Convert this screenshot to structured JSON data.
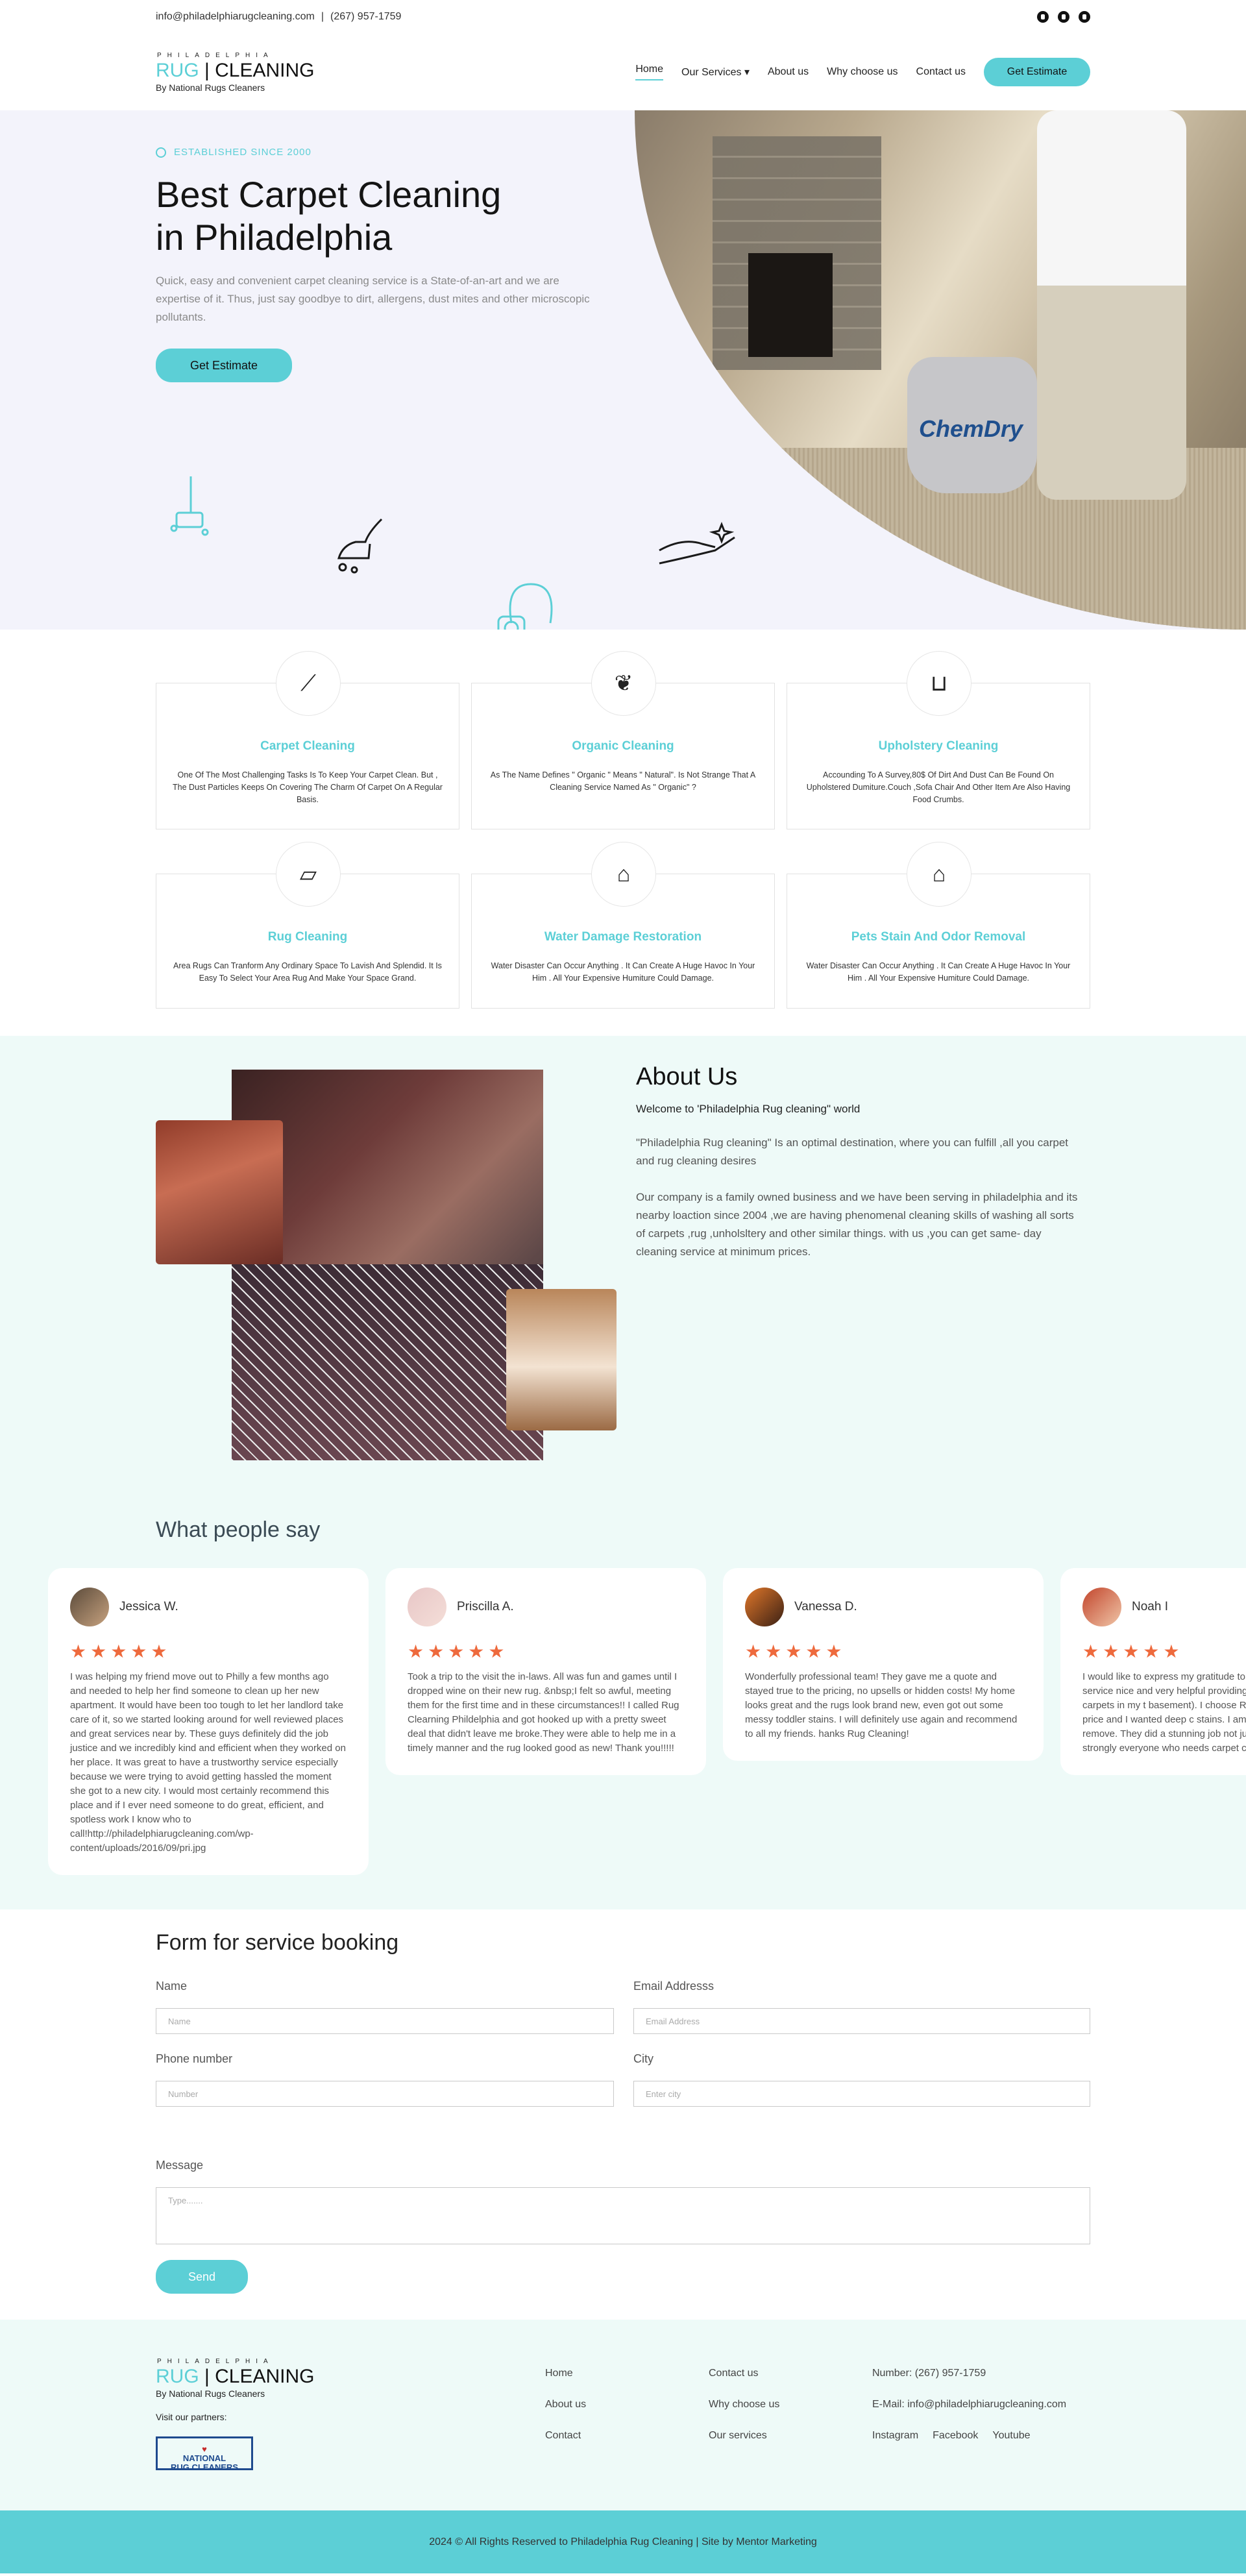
{
  "topbar": {
    "email": "info@philadelphiarugcleaning.com",
    "separator": "|",
    "phone": "(267) 957-1759",
    "social": [
      "facebook-icon",
      "instagram-icon",
      "youtube-icon"
    ]
  },
  "logo": {
    "line1": "PHILADELPHIA",
    "word1": "RUG",
    "word2": "CLEANING",
    "line3": "By National Rugs Cleaners"
  },
  "nav": {
    "items": [
      "Home",
      "Our Services",
      "About us",
      "Why choose us",
      "Contact us"
    ],
    "cta": "Get Estimate"
  },
  "hero": {
    "established": "ESTABLISHED SINCE 2000",
    "title_line1": "Best Carpet Cleaning",
    "title_line2": "in Philadelphia",
    "lead": "Quick, easy and convenient carpet cleaning service is a State-of-an-art and we are expertise of it. Thus, just say goodbye to dirt, allergens, dust mites and other microscopic pollutants.",
    "cta": "Get Estimate"
  },
  "services": [
    {
      "title": "Carpet Cleaning",
      "text": "One Of The Most Challenging Tasks Is To Keep Your Carpet Clean. But , The Dust Particles Keeps On Covering The Charm Of Carpet On A Regular Basis."
    },
    {
      "title": "Organic Cleaning",
      "text": "As The Name Defines \" Organic \" Means \" Natural\". Is Not Strange That A Cleaning Service Named As \" Organic\" ?"
    },
    {
      "title": "Upholstery Cleaning",
      "text": "Accounding To A Survey,80$ Of Dirt And Dust Can Be Found On Upholstered Dumiture.Couch ,Sofa Chair And Other Item Are Also Having Food Crumbs."
    },
    {
      "title": "Rug Cleaning",
      "text": "Area Rugs Can Tranform Any Ordinary Space To Lavish And Splendid. It Is Easy To Select Your Area Rug And Make Your Space Grand."
    },
    {
      "title": "Water Damage Restoration",
      "text": "Water Disaster Can Occur Anything . It Can Create A Huge Havoc In Your Him . All Your Expensive Humiture Could Damage."
    },
    {
      "title": "Pets Stain And Odor Removal",
      "text": "Water Disaster Can Occur Anything . It Can Create A Huge Havoc In Your Him . All Your Expensive Humiture Could Damage."
    }
  ],
  "about": {
    "title": "About Us",
    "welcome": "Welcome to 'Philadelphia Rug cleaning\" world",
    "p1": "\"Philadelphia Rug cleaning\" Is an optimal destination, where you can fulfill ,all you carpet and rug cleaning desires",
    "p2": "Our company is a family owned business and we have been serving in philadelphia and its nearby loaction since 2004 ,we are having phenomenal cleaning skills of washing all sorts of carpets ,rug ,unholsltery and other similar things. with us ,you can get same- day cleaning service at minimum prices."
  },
  "testimonials": {
    "title": "What people say",
    "stars": "★★★★★",
    "items": [
      {
        "name": "Jessica W.",
        "text": "I was helping my friend move out to Philly a few months ago and needed to help her find someone to clean up her new apartment. It would have been too tough to let her landlord take care of it, so we started looking around for well reviewed places and great services near by. These guys definitely did the job justice and we incredibly kind and efficient when they worked on her place. It was great to have a trustworthy service especially because we were trying to avoid getting hassled the moment she got to a new city. I would most certainly recommend this place and if I ever need someone to do great, efficient, and spotless work I know who to call!http://philadelphiarugcleaning.com/wp-content/uploads/2016/09/pri.jpg"
      },
      {
        "name": "Priscilla A.",
        "text": "Took a trip to the visit the in-laws. All was fun and games until I dropped wine on their new rug. &nbsp;I felt so awful, meeting them for the first time and in these circumstances!! I called Rug Clearning Phildelphia and got hooked up with a pretty sweet deal that didn't leave me broke.They were able to help me in a timely manner and the rug looked good as new! Thank you!!!!!"
      },
      {
        "name": "Vanessa D.",
        "text": "Wonderfully professional team! They gave me a quote and stayed true to the pricing, no upsells or hidden costs! My home looks great and the rugs look brand new, even got out some messy toddler stains. I will definitely use again and recommend to all my friends. hanks Rug Cleaning!"
      },
      {
        "name": "Noah I",
        "text": "I would like to express my gratitude to Philadelphia for the wonderful service nice and very helpful providing carpet wanted to clean all my carpets in my t basement). I choose Rug cleaning Phi gave a good price and I wanted deep c stains. I am very impressed – obviousl remove. They did a stunning job not ju my carpets. It was priceless. I strongly everyone who needs carpet cleaning s"
      }
    ]
  },
  "form": {
    "title": "Form for service booking",
    "name_label": "Name",
    "name_placeholder": "Name",
    "email_label": "Email Addresss",
    "email_placeholder": "Email Address",
    "phone_label": "Phone number",
    "phone_placeholder": "Number",
    "city_label": "City",
    "city_placeholder": "Enter city",
    "message_label": "Message",
    "message_placeholder": "Type.......",
    "submit": "Send"
  },
  "footer": {
    "partners_label": "Visit our partners:",
    "partner_name_1": "NATIONAL",
    "partner_name_2": "RUG CLEANERS",
    "col1": [
      "Home",
      "About us",
      "Contact"
    ],
    "col2": [
      "Contact us",
      "Why choose us",
      "Our services"
    ],
    "number": "Number: (267) 957-1759",
    "email": "E-Mail: info@philadelphiarugcleaning.com",
    "social": [
      "Instagram",
      "Facebook",
      "Youtube"
    ],
    "copyright": "2024 © All Rights Reserved to Philadelphia Rug Cleaning | Site by Mentor Marketing"
  }
}
